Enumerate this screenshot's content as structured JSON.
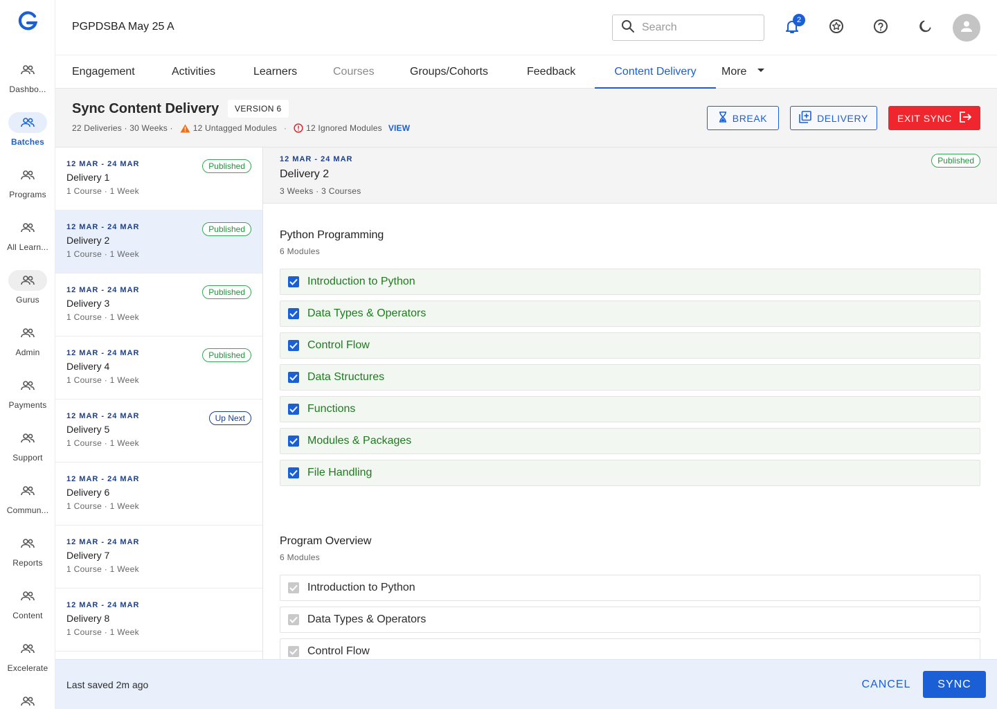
{
  "rail": {
    "items": [
      {
        "label": "Dashbo..."
      },
      {
        "label": "Batches"
      },
      {
        "label": "Programs"
      },
      {
        "label": "All Learn..."
      },
      {
        "label": "Gurus"
      },
      {
        "label": "Admin"
      },
      {
        "label": "Payments"
      },
      {
        "label": "Support"
      },
      {
        "label": "Commun..."
      },
      {
        "label": "Reports"
      },
      {
        "label": "Content"
      },
      {
        "label": "Excelerate"
      },
      {
        "label": ""
      }
    ]
  },
  "header": {
    "batch_title": "PGPDSBA May 25 A",
    "search_placeholder": "Search",
    "notification_count": "2"
  },
  "tabs": [
    {
      "label": "Engagement"
    },
    {
      "label": "Activities"
    },
    {
      "label": "Learners"
    },
    {
      "label": "Courses"
    },
    {
      "label": "Groups/Cohorts"
    },
    {
      "label": "Feedback"
    },
    {
      "label": "Content Delivery"
    },
    {
      "label": "More"
    }
  ],
  "sync": {
    "title": "Sync Content Delivery",
    "version": "VERSION 6",
    "stats": "22 Deliveries · 30 Weeks ·",
    "untagged": "12 Untagged Modules",
    "dot": "·",
    "ignored": "12 Ignored Modules",
    "view": "VIEW",
    "break_label": "BREAK",
    "delivery_label": "DELIVERY",
    "exit_label": "EXIT SYNC"
  },
  "deliveries": [
    {
      "date": "12 MAR - 24 MAR",
      "name": "Delivery 1",
      "meta": "1 Course · 1 Week",
      "status": "Published"
    },
    {
      "date": "12 MAR - 24 MAR",
      "name": "Delivery 2",
      "meta": "1 Course · 1 Week",
      "status": "Published"
    },
    {
      "date": "12 MAR - 24 MAR",
      "name": "Delivery 3",
      "meta": "1 Course · 1 Week",
      "status": "Published"
    },
    {
      "date": "12 MAR - 24 MAR",
      "name": "Delivery 4",
      "meta": "1 Course · 1 Week",
      "status": "Published"
    },
    {
      "date": "12 MAR - 24 MAR",
      "name": "Delivery 5",
      "meta": "1 Course · 1 Week",
      "status": "Up Next"
    },
    {
      "date": "12 MAR - 24 MAR",
      "name": "Delivery 6",
      "meta": "1 Course · 1 Week",
      "status": ""
    },
    {
      "date": "12 MAR - 24 MAR",
      "name": "Delivery 7",
      "meta": "1 Course · 1 Week",
      "status": ""
    },
    {
      "date": "12 MAR - 24 MAR",
      "name": "Delivery 8",
      "meta": "1 Course · 1 Week",
      "status": ""
    }
  ],
  "detail": {
    "date": "12 MAR - 24 MAR",
    "title": "Delivery 2",
    "meta": "3 Weeks · 3 Courses",
    "status": "Published",
    "sections": [
      {
        "title": "Python Programming",
        "subtitle": "6 Modules",
        "modules": [
          {
            "label": "Introduction to Python",
            "checked": true
          },
          {
            "label": "Data Types & Operators",
            "checked": true
          },
          {
            "label": "Control Flow",
            "checked": true
          },
          {
            "label": "Data Structures",
            "checked": true
          },
          {
            "label": "Functions",
            "checked": true
          },
          {
            "label": "Modules & Packages",
            "checked": true
          },
          {
            "label": "File Handling",
            "checked": true
          }
        ]
      },
      {
        "title": "Program Overview",
        "subtitle": "6 Modules",
        "modules": [
          {
            "label": "Introduction to Python",
            "checked": true
          },
          {
            "label": "Data Types & Operators",
            "checked": true
          },
          {
            "label": "Control Flow",
            "checked": true
          }
        ]
      }
    ]
  },
  "footer": {
    "saved": "Last saved 2m ago",
    "cancel": "CANCEL",
    "sync": "SYNC"
  },
  "colors": {
    "primary": "#1a5fd6",
    "danger": "#f0262f",
    "success": "#23913e",
    "navy": "#1b3f8a"
  }
}
